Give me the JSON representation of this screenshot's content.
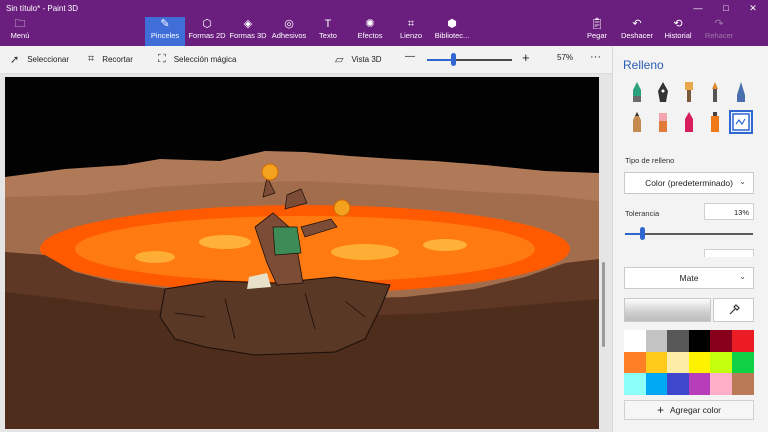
{
  "app": {
    "title": "Sin título* - Paint 3D"
  },
  "window_controls": {
    "minimize": "—",
    "maximize": "□",
    "close": "✕"
  },
  "toolbar": {
    "menu_label": "Menú",
    "tools": [
      {
        "label": "Pinceles",
        "icon": "brush-icon",
        "active": true
      },
      {
        "label": "Formas 2D",
        "icon": "shapes-2d-icon"
      },
      {
        "label": "Formas 3D",
        "icon": "shapes-3d-icon"
      },
      {
        "label": "Adhesivos",
        "icon": "stickers-icon"
      },
      {
        "label": "Texto",
        "icon": "text-icon"
      },
      {
        "label": "Efectos",
        "icon": "effects-icon"
      },
      {
        "label": "Lienzo",
        "icon": "canvas-icon"
      },
      {
        "label": "Bibliotec...",
        "icon": "library-icon"
      }
    ],
    "actions": [
      {
        "label": "Pegar",
        "icon": "paste-icon"
      },
      {
        "label": "Deshacer",
        "icon": "undo-icon"
      },
      {
        "label": "Historial",
        "icon": "history-icon"
      },
      {
        "label": "Rehacer",
        "icon": "redo-icon",
        "disabled": true
      }
    ]
  },
  "subbar": {
    "select_label": "Seleccionar",
    "crop_label": "Recortar",
    "magic_select_label": "Selección mágica",
    "view3d_label": "Vista 3D",
    "zoom_minus": "—",
    "zoom_plus": "+",
    "zoom_value": "57%",
    "zoom_fraction": 0.3,
    "more": "···"
  },
  "panel": {
    "title": "Relleno",
    "brushes": [
      "marker-icon",
      "calligraphy-pen-icon",
      "oil-brush-icon",
      "watercolor-icon",
      "pixel-pen-icon",
      "pencil-icon",
      "eraser-icon",
      "crayon-icon",
      "spray-can-icon",
      "fill-icon"
    ],
    "fill_type_label": "Tipo de relleno",
    "fill_type_value": "Color (predeterminado)",
    "tolerance_label": "Tolerancia",
    "tolerance_value": "13%",
    "tolerance_fraction": 0.13,
    "finish_value": "Mate",
    "add_color_label": "Agregar color",
    "add_icon": "+",
    "colors": [
      "#ffffff",
      "#c3c3c3",
      "#585858",
      "#000000",
      "#88001b",
      "#ec1c24",
      "#ff7f27",
      "#ffca18",
      "#fdeca6",
      "#fff200",
      "#c4ff0e",
      "#0ed145",
      "#8cfffb",
      "#00a8f3",
      "#3f48cc",
      "#b83dba",
      "#ffaec8",
      "#b97a56"
    ]
  }
}
